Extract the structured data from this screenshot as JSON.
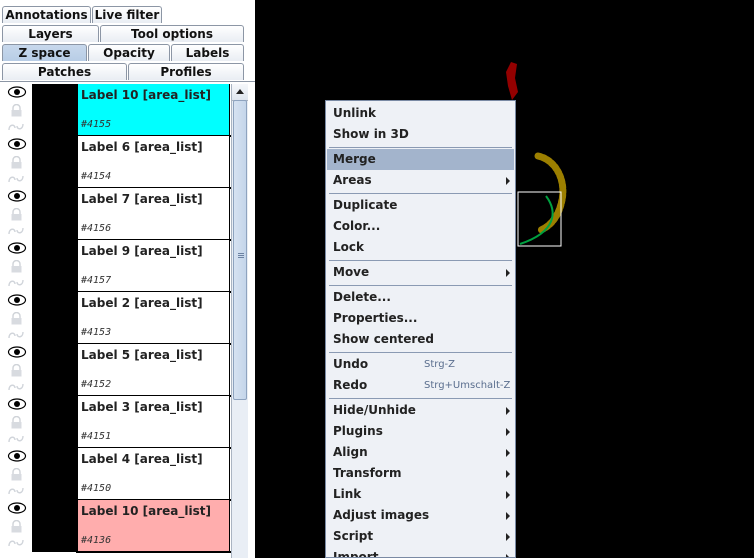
{
  "tabs": {
    "row1": [
      "Annotations",
      "Live filter"
    ],
    "row2": [
      "Layers",
      "Tool options"
    ],
    "row3": [
      "Z space",
      "Opacity",
      "Labels"
    ],
    "row4": [
      "Patches",
      "Profiles"
    ],
    "selected": "Z space"
  },
  "rows": [
    {
      "title": "Label 10 [area_list]",
      "id": "#4155",
      "color": "#00ffff"
    },
    {
      "title": "Label 6 [area_list]",
      "id": "#4154",
      "color": "#ffffff"
    },
    {
      "title": "Label 7 [area_list]",
      "id": "#4156",
      "color": "#ffffff"
    },
    {
      "title": "Label 9 [area_list]",
      "id": "#4157",
      "color": "#ffffff"
    },
    {
      "title": "Label 2 [area_list]",
      "id": "#4153",
      "color": "#ffffff"
    },
    {
      "title": "Label 5 [area_list]",
      "id": "#4152",
      "color": "#ffffff"
    },
    {
      "title": "Label 3 [area_list]",
      "id": "#4151",
      "color": "#ffffff"
    },
    {
      "title": "Label 4 [area_list]",
      "id": "#4150",
      "color": "#ffffff"
    },
    {
      "title": "Label 10 [area_list]",
      "id": "#4136",
      "color": "#ffadad"
    }
  ],
  "menu": {
    "items": [
      {
        "label": "Unlink"
      },
      {
        "label": "Show in 3D"
      },
      {
        "sep": true
      },
      {
        "label": "Merge",
        "highlight": true
      },
      {
        "label": "Areas",
        "sub": true
      },
      {
        "sep": true
      },
      {
        "label": "Duplicate"
      },
      {
        "label": "Color..."
      },
      {
        "label": "Lock"
      },
      {
        "sep": true
      },
      {
        "label": "Move",
        "sub": true
      },
      {
        "sep": true
      },
      {
        "label": "Delete..."
      },
      {
        "label": "Properties..."
      },
      {
        "label": "Show centered"
      },
      {
        "sep": true
      },
      {
        "label": "Undo",
        "shortcut": "Strg-Z"
      },
      {
        "label": "Redo",
        "shortcut": "Strg+Umschalt-Z"
      },
      {
        "sep": true
      },
      {
        "label": "Hide/Unhide",
        "sub": true
      },
      {
        "label": "Plugins",
        "sub": true
      },
      {
        "label": "Align",
        "sub": true
      },
      {
        "label": "Transform",
        "sub": true
      },
      {
        "label": "Link",
        "sub": true
      },
      {
        "label": "Adjust images",
        "sub": true
      },
      {
        "label": "Script",
        "sub": true
      },
      {
        "label": "Import",
        "sub": true
      }
    ]
  },
  "colors": {
    "selected_row": "#00ffff",
    "active_row": "#ffadad",
    "canvas": "#000000",
    "shape_red": "#9b0000",
    "shape_olive": "#9c7f00",
    "shape_green": "#00a040"
  }
}
